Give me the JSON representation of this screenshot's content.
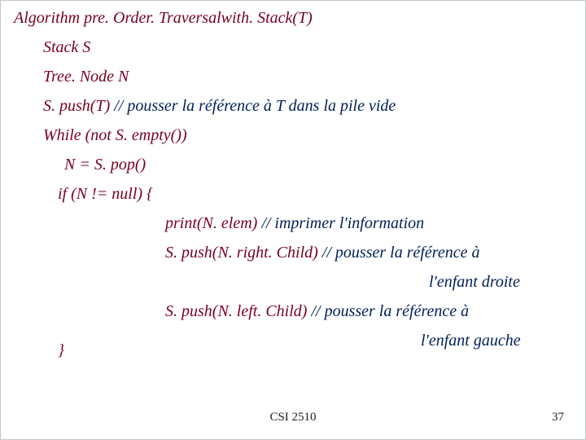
{
  "title": "Algorithm pre. Order. Traversalwith. Stack(T)",
  "l1": "Stack S",
  "l2": "Tree. Node N",
  "l3a": "S. push(T)   ",
  "l3b": "// pousser la référence à T dans la pile vide",
  "l4": "While (not S. empty())",
  "l5": "N = S. pop()",
  "l6": "if (N != null) {",
  "l7a": "print(N. elem)           ",
  "l7b": "// imprimer l'information",
  "l8a": "S. push(N. right. Child) ",
  "l8b": "// pousser la référence à",
  "l9": "l'enfant droite",
  "l10a": "S. push(N. left. Child) ",
  "l10b": "// pousser la référence à",
  "l11": "l'enfant gauche",
  "l12": "}",
  "footer_center": "CSI 2510",
  "footer_right": "37"
}
